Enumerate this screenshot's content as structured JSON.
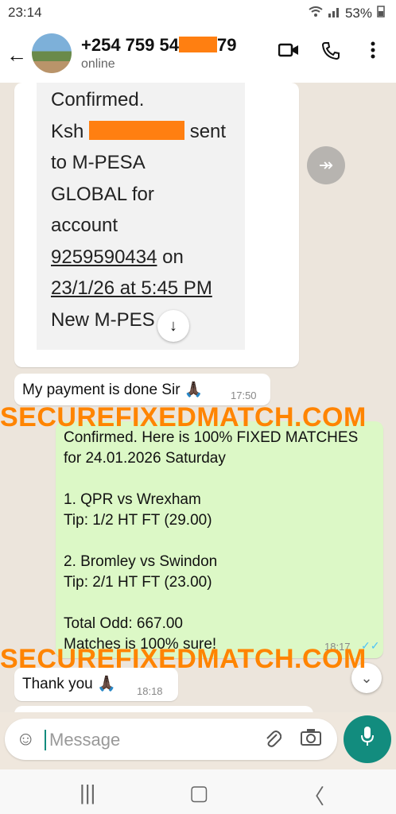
{
  "status_bar": {
    "time": "23:14",
    "battery": "53%"
  },
  "header": {
    "contact_prefix": "+254 759 54",
    "contact_suffix": "79",
    "status": "online"
  },
  "sms_screenshot": {
    "lines": [
      "Confirmed.",
      "Ksh",
      "sent",
      "to M-PESA",
      "GLOBAL for",
      "account",
      "9259590434",
      "on",
      "23/1/26 at 5:45 PM",
      "New M-PES"
    ],
    "time": "17:50"
  },
  "messages": {
    "payment": {
      "text": "My payment is done Sir 🙏🏿",
      "time": "17:50"
    },
    "fixed": {
      "lines": [
        "Confirmed. Here is 100% FIXED MATCHES",
        "for 24.01.2026 Saturday",
        "",
        "1. QPR vs Wrexham",
        "Tip: 1/2 HT FT (29.00)",
        "",
        "2. Bromley vs Swindon",
        "Tip: 2/1 HT FT (23.00)",
        "",
        "Total Odd: 667.00",
        "Matches is 100% sure!"
      ],
      "time": "18:17"
    },
    "thanks": {
      "text": "Thank you 🙏🏿",
      "time": "18:18"
    }
  },
  "watermark": "SECUREFIXEDMATCH.COM",
  "input": {
    "placeholder": "Message"
  },
  "icons": {
    "back": "arrow-left-icon",
    "video": "video-call-icon",
    "call": "phone-icon",
    "menu": "more-vertical-icon",
    "emoji": "emoji-icon",
    "attach": "paperclip-icon",
    "camera": "camera-icon",
    "mic": "mic-icon",
    "forward": "forward-icon"
  },
  "colors": {
    "accent": "#128c7e",
    "outgoing": "#dcf8c6",
    "watermark": "#ff8400",
    "redaction": "#ff7f11"
  }
}
